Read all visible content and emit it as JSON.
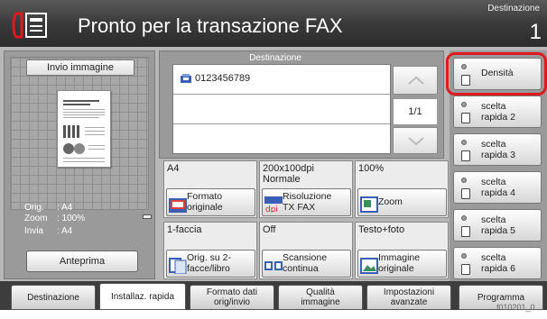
{
  "header": {
    "title": "Pronto per la transazione FAX",
    "destination_label": "Destinazione",
    "destination_count": "1"
  },
  "preview": {
    "tab_label": "Invio immagine",
    "info": [
      {
        "key": "Orig.",
        "value": ": A4"
      },
      {
        "key": "Zoom",
        "value": ": 100%"
      },
      {
        "key": "Invia",
        "value": ": A4"
      }
    ],
    "preview_button": "Anteprima"
  },
  "destination": {
    "title": "Destinazione",
    "entries": [
      "0123456789",
      "",
      ""
    ],
    "page_indicator": "1/1"
  },
  "functions": [
    {
      "value": "A4",
      "value2": "",
      "button": "Formato\noriginale",
      "icon": "original-size-icon"
    },
    {
      "value": "200x100dpi",
      "value2": "Normale",
      "button": "Risoluzione\nTX FAX",
      "icon": "fax-resolution-icon"
    },
    {
      "value": "100%",
      "value2": "",
      "button": "Zoom",
      "icon": "zoom-icon"
    },
    {
      "value": "1-faccia",
      "value2": "",
      "button": "Orig. su 2-\nfacce/libro",
      "icon": "duplex-icon"
    },
    {
      "value": "Off",
      "value2": "",
      "button": "Scansione\ncontinua",
      "icon": "continuous-scan-icon"
    },
    {
      "value": "Testo+foto",
      "value2": "",
      "button": "Immagine\noriginale",
      "icon": "original-image-icon"
    }
  ],
  "quick_buttons": [
    {
      "label": "Densità"
    },
    {
      "label": "scelta\nrapida 2"
    },
    {
      "label": "scelta\nrapida 3"
    },
    {
      "label": "scelta\nrapida 4"
    },
    {
      "label": "scelta\nrapida 5"
    },
    {
      "label": "scelta\nrapida 6"
    }
  ],
  "tabs": [
    {
      "label": "Destinazione"
    },
    {
      "label": "Installaz. rapida"
    },
    {
      "label": "Formato dati\norig/invio"
    },
    {
      "label": "Qualità\nimmagine"
    },
    {
      "label": "Impostazioni\navanzate"
    },
    {
      "label": "Programma"
    }
  ],
  "footer_id": "f010201_0",
  "colors": {
    "header": "#3a3a3a",
    "panel": "#9a9a9a",
    "highlight": "#e0191f"
  }
}
